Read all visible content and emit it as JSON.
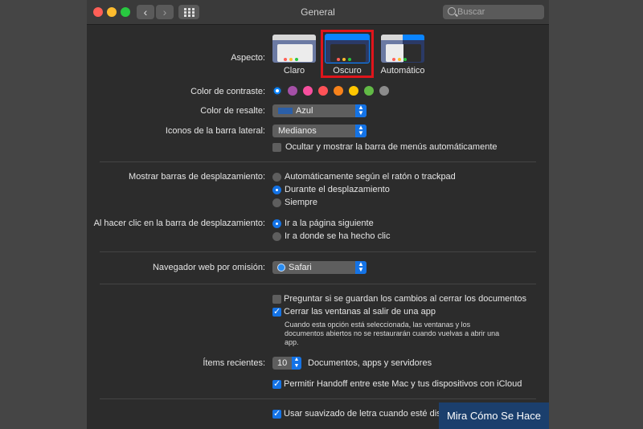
{
  "window": {
    "title": "General",
    "search_placeholder": "Buscar"
  },
  "appearance": {
    "label": "Aspecto:",
    "options": [
      {
        "name": "Claro",
        "selected": false
      },
      {
        "name": "Oscuro",
        "selected": true
      },
      {
        "name": "Automático",
        "selected": false
      }
    ]
  },
  "contrast": {
    "label": "Color de contraste:",
    "colors": [
      "#0a84ff",
      "#a550a7",
      "#f74f9e",
      "#ff5257",
      "#f7821b",
      "#ffc600",
      "#62ba46",
      "#8c8c8c"
    ],
    "selected_index": 0
  },
  "highlight": {
    "label": "Color de resalte:",
    "value": "Azul"
  },
  "sidebar_icons": {
    "label": "Iconos de la barra lateral:",
    "value": "Medianos"
  },
  "menu_bar": {
    "label": "Ocultar y mostrar la barra de menús automáticamente",
    "checked": false
  },
  "scroll_bars": {
    "label": "Mostrar barras de desplazamiento:",
    "options": [
      "Automáticamente según el ratón o trackpad",
      "Durante el desplazamiento",
      "Siempre"
    ],
    "selected_index": 1
  },
  "scroll_click": {
    "label": "Al hacer clic en la barra de desplazamiento:",
    "options": [
      "Ir a la página siguiente",
      "Ir a donde se ha hecho clic"
    ],
    "selected_index": 0
  },
  "browser": {
    "label": "Navegador web por omisión:",
    "value": "Safari"
  },
  "ask_save": {
    "label": "Preguntar si se guardan los cambios al cerrar los documentos",
    "checked": false
  },
  "close_windows": {
    "label": "Cerrar las ventanas al salir de una app",
    "checked": true,
    "help_lines": [
      "Cuando esta opción está seleccionada, las ventanas y los",
      "documentos abiertos no se restaurarán cuando vuelvas a abrir una",
      "app."
    ]
  },
  "recent_items": {
    "label": "Ítems recientes:",
    "value": "10",
    "suffix": "Documentos, apps y servidores"
  },
  "handoff": {
    "label": "Permitir Handoff entre este Mac y tus dispositivos con iCloud",
    "checked": true
  },
  "font_smoothing": {
    "label": "Usar suavizado de letra cuando esté dis",
    "checked": true
  },
  "watermark": "Mira Cómo Se Hace"
}
